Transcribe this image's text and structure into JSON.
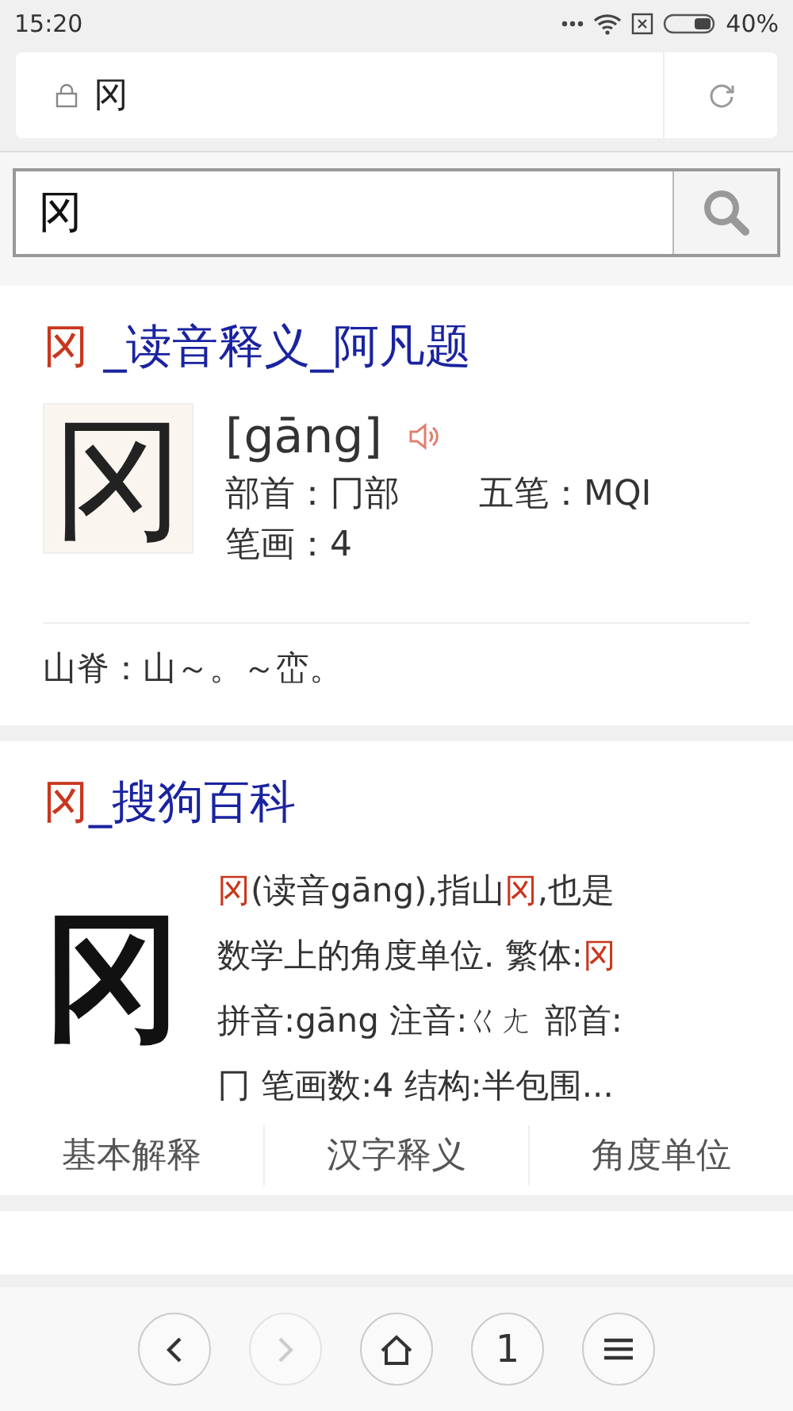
{
  "status_bar": {
    "time": "15:20",
    "battery": "40%"
  },
  "address_bar": {
    "text": "冈"
  },
  "search": {
    "value": "冈"
  },
  "results": [
    {
      "kind": "dictionary",
      "title": [
        {
          "text": "冈",
          "highlight": true
        },
        {
          "text": " _读音释义_阿凡题",
          "highlight": false
        }
      ],
      "glyph": "冈",
      "pinyin": "[gāng]",
      "fields": [
        [
          "部首：冂部",
          "五笔：MQI"
        ],
        [
          "笔画：4"
        ]
      ],
      "definition": "山脊：山～。～峦。"
    },
    {
      "kind": "encyclopedia",
      "title": [
        {
          "text": "冈",
          "highlight": true
        },
        {
          "text": "_搜狗百科",
          "highlight": false
        }
      ],
      "glyph": "冈",
      "lines": [
        [
          {
            "text": "冈",
            "highlight": true
          },
          {
            "text": "(读音gāng),指山",
            "highlight": false
          },
          {
            "text": "冈",
            "highlight": true
          },
          {
            "text": ",也是",
            "highlight": false
          }
        ],
        [
          {
            "text": "数学上的角度单位. 繁体:",
            "highlight": false
          },
          {
            "text": "冈",
            "highlight": true
          }
        ],
        [
          {
            "text": "拼音:gāng 注音:ㄍㄤ 部首:",
            "highlight": false
          }
        ],
        [
          {
            "text": "冂 笔画数:4 结构:半包围...",
            "highlight": false
          }
        ]
      ],
      "tabs": [
        "基本解释",
        "汉字释义",
        "角度单位"
      ]
    }
  ],
  "toolbar": [
    {
      "kind": "back",
      "disabled": false
    },
    {
      "kind": "forward",
      "disabled": true
    },
    {
      "kind": "home",
      "disabled": false
    },
    {
      "kind": "tabs",
      "label": "1",
      "disabled": false
    },
    {
      "kind": "menu",
      "disabled": false
    }
  ]
}
